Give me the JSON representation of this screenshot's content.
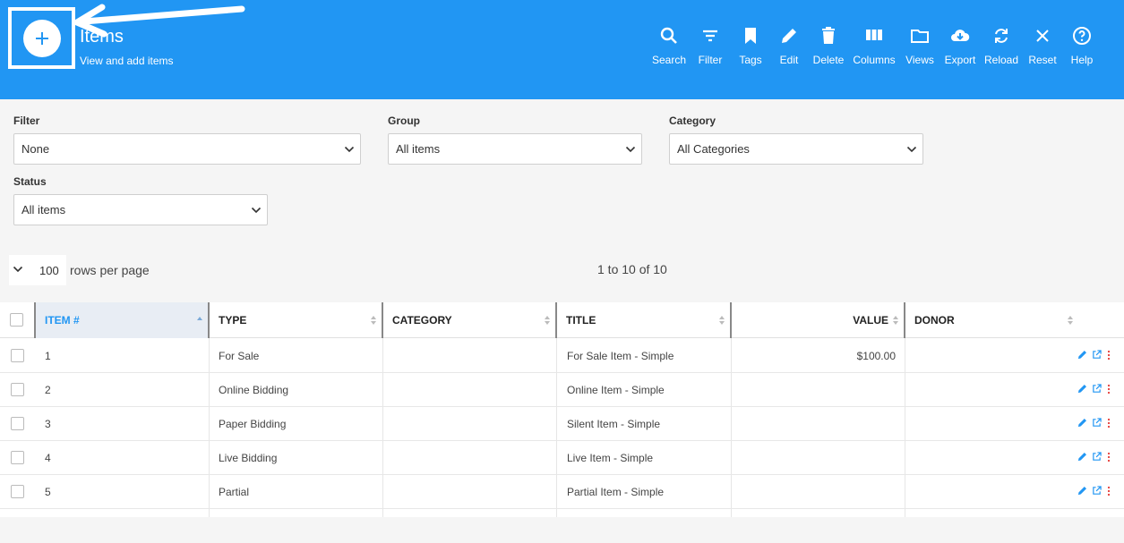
{
  "header": {
    "title": "Items",
    "subtitle": "View and add items",
    "add_icon": "plus-icon",
    "bg_color": "#2196f3",
    "toolbar": [
      {
        "label": "Search",
        "icon": "search-icon"
      },
      {
        "label": "Filter",
        "icon": "filter-icon"
      },
      {
        "label": "Tags",
        "icon": "bookmark-icon"
      },
      {
        "label": "Edit",
        "icon": "pencil-icon"
      },
      {
        "label": "Delete",
        "icon": "trash-icon"
      },
      {
        "label": "Columns",
        "icon": "columns-icon"
      },
      {
        "label": "Views",
        "icon": "folder-icon"
      },
      {
        "label": "Export",
        "icon": "cloud-download-icon"
      },
      {
        "label": "Reload",
        "icon": "refresh-icon"
      },
      {
        "label": "Reset",
        "icon": "close-icon"
      },
      {
        "label": "Help",
        "icon": "help-icon"
      }
    ]
  },
  "filters": {
    "filter": {
      "label": "Filter",
      "value": "None"
    },
    "group": {
      "label": "Group",
      "value": "All items"
    },
    "category": {
      "label": "Category",
      "value": "All Categories"
    },
    "status": {
      "label": "Status",
      "value": "All items"
    }
  },
  "pager": {
    "rows_per_page": "100",
    "rows_per_page_label": "rows per page",
    "range": "1 to 10 of 10"
  },
  "table": {
    "columns": [
      "ITEM #",
      "TYPE",
      "CATEGORY",
      "TITLE",
      "VALUE",
      "DONOR"
    ],
    "rows": [
      {
        "item": "1",
        "type": "For Sale",
        "category": "",
        "title": "For Sale Item - Simple",
        "value": "$100.00",
        "donor": ""
      },
      {
        "item": "2",
        "type": "Online Bidding",
        "category": "",
        "title": "Online Item - Simple",
        "value": "",
        "donor": ""
      },
      {
        "item": "3",
        "type": "Paper Bidding",
        "category": "",
        "title": "Silent Item - Simple",
        "value": "",
        "donor": ""
      },
      {
        "item": "4",
        "type": "Live Bidding",
        "category": "",
        "title": "Live Item - Simple",
        "value": "",
        "donor": ""
      },
      {
        "item": "5",
        "type": "Partial",
        "category": "",
        "title": "Partial Item - Simple",
        "value": "",
        "donor": ""
      }
    ]
  }
}
